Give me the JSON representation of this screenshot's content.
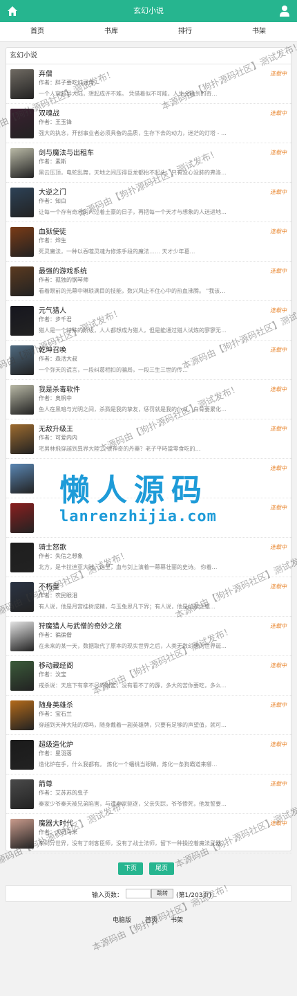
{
  "header": {
    "title": "玄幻小说"
  },
  "nav": [
    "首页",
    "书库",
    "排行",
    "书架"
  ],
  "panel_title": "玄幻小说",
  "books": [
    {
      "name": "弃僧",
      "author": "作者：胖子要吃炖豆角",
      "intro": "一个人穿越异大陆，想起成许不难。 凭借着似不可能，人生会碰到的奇…",
      "status": "连载中",
      "color": "#6f6a62"
    },
    {
      "name": "双魂战",
      "author": "作者：王玉锋",
      "intro": "强大的执念，开创事业者必须具备的品质，生存下去的动力，迷茫的灯塔 - 王强…",
      "status": "连载中",
      "color": "#3a2030"
    },
    {
      "name": "剑与魔法与出租车",
      "author": "作者：素斯",
      "intro": "黑云压顶，电蛇乱舞，天地之间压得巨龙都抬不起头，只有没心没肺的弗洛还能看…",
      "status": "连载中",
      "color": "#b9b9a6"
    },
    {
      "name": "大逆之门",
      "author": "作者：知白",
      "intro": "让每一个存有奇念的人过着土豪的日子，再把每一个天才与想象的人送进地狱。法到…",
      "status": "连载中",
      "color": "#2d4257"
    },
    {
      "name": "血狱使徒",
      "author": "作者：烨生",
      "intro": "死灵魔法，一种以吞噬灵魂为修炼手段的魔法…… 天才少年葛…",
      "status": "连载中",
      "color": "#7a3b16"
    },
    {
      "name": "最强的游戏系统",
      "author": "作者：孤独的钢琴师",
      "intro": "看着眼前的光幕中琳琅满目的技能，数兴风止不住心中的热血沸腾。 \"我该怎样使…",
      "status": "连载中",
      "color": "#5b3a1f"
    },
    {
      "name": "元气猎人",
      "author": "作者：步千君",
      "intro": "猎人是一个特殊的阶级，人人都想成为猎人，但是能通过猎人试炼的寥寥无几…",
      "status": "连载中",
      "color": "#16161e"
    },
    {
      "name": "乾坤召唤",
      "author": "作者：森活大叔",
      "intro": "一个弥天的谎言，一段纠葛相扣的骗局，一段三生三世的传…",
      "status": "连载中",
      "color": "#4f6a80"
    },
    {
      "name": "我是杀毒软件",
      "author": "作者：奥帆中",
      "intro": "鱼人在黑暗与光明之间，杀戮是我的挚友，惩罚就是我的仆从，白骨要累化作我…",
      "status": "连载中",
      "color": "#b9b9a6"
    },
    {
      "name": "无敌升级王",
      "author": "作者：可爱内内",
      "intro": "宅男林飛穿越到異界大陸… 很神奇的丹藥？老子平時當零食吃的…",
      "status": "连载中",
      "color": "#9d6b2f"
    },
    {
      "name": "",
      "author": "",
      "intro": "",
      "status": "连载中",
      "color": "#5a86b3"
    },
    {
      "name": "",
      "author": "",
      "intro": "",
      "status": "连载中",
      "color": "#8a1f1f"
    },
    {
      "name": "骑士怒歌",
      "author": "作者：失信之想象",
      "intro": "北方，是卡拉迪亚大陆。这里，血与剑上演着一幕幕壮丽的史诗。 你着…",
      "status": "连载中",
      "color": "#1e1e1e"
    },
    {
      "name": "不朽皇",
      "author": "作者：农民眼泪",
      "intro": "有人说，他是月宫桂树成精，与玉兔思凡下界；有人说，他是仙家之躯…",
      "status": "连载中",
      "color": "#2b3444"
    },
    {
      "name": "狩魔猎人与武僧的奇妙之旅",
      "author": "作者：徧徧僧",
      "intro": "在未来的某一天，数据取代了原本的现实世界之后，人类无数幻想的世界诞生了…",
      "status": "连载中",
      "color": "#e3e3e3"
    },
    {
      "name": "移动藏经阁",
      "author": "作者：汶宝",
      "intro": "戒杀说：天底下有拿不尽的财宝，没有看不了的霹，多大的苦你要吃，多么的罪你要…",
      "status": "连载中",
      "color": "#3b5b3a"
    },
    {
      "name": "随身英雄杀",
      "author": "作者：宝石兰",
      "intro": "穿越到天神大陆的郑鸣，随身戴着一副英雄牌，只要有足够的声望值，就可以召唤出…",
      "status": "连载中",
      "color": "#b36a1a"
    },
    {
      "name": "超级造化炉",
      "author": "作者：星羽落",
      "intro": "造化炉在手，什么我都有。 炼化一个蟠桃当眼睛，炼化一条狗霸道来哪…",
      "status": "连载中",
      "color": "#1a1a1a"
    },
    {
      "name": "箭尊",
      "author": "作者：艾苏苏的虫子",
      "intro": "秦家少爷秦天被兄弟陷害，与遭秦家驱逐，父亲失踪，爷爷惨死，他发誓要打败敌…",
      "status": "连载中",
      "color": "#4a4a4a"
    },
    {
      "name": "魔器大时代",
      "author": "作者：大司马米",
      "intro": "来到异世界，没有了刺客臣师，没有了战士法师，留下一种操控着魔法武器的战…",
      "status": "连载中",
      "color": "#c99b8c"
    }
  ],
  "pager": {
    "next": "下页",
    "last": "尾页"
  },
  "jump": {
    "label": "输入页数：",
    "button": "跳转",
    "page_info": "(第1/203页)"
  },
  "footer": [
    "电脑版",
    "首页",
    "书架"
  ],
  "watermark": "本源码由【狗扑源码社区】测试发布！",
  "logo": {
    "main": "懒人源码",
    "url": "lanrenzhijia.com"
  },
  "colors": {
    "accent": "#26b58f",
    "status": "#e8842b",
    "logo": "#1e9bd8"
  }
}
